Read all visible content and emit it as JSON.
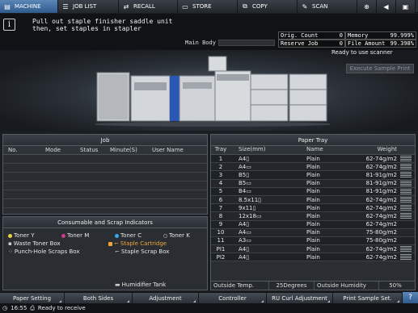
{
  "nav": {
    "tabs": [
      {
        "label": "MACHINE",
        "icon": "printer-icon"
      },
      {
        "label": "JOB LIST",
        "icon": "list-icon"
      },
      {
        "label": "RECALL",
        "icon": "recall-icon"
      },
      {
        "label": "STORE",
        "icon": "store-icon"
      },
      {
        "label": "COPY",
        "icon": "copy-icon"
      },
      {
        "label": "SCAN",
        "icon": "scan-icon"
      }
    ],
    "extra_icons": [
      "globe-icon",
      "speaker-icon",
      "lock-icon",
      "help-icon"
    ]
  },
  "message": {
    "line1": "Pull out staple finisher saddle unit",
    "line2": "then, set staples in stapler",
    "main_body_label": "Main Body"
  },
  "counters": {
    "orig_count_label": "Orig. Count",
    "orig_count": "0",
    "memory_label": "Memory",
    "memory": "99.999%",
    "reserve_job_label": "Reserve Job",
    "reserve_job": "0",
    "file_amount_label": "File Amount",
    "file_amount": "99.398%"
  },
  "status_text": "Ready to use scanner",
  "execute_sample_print": "Execute Sample Print",
  "job": {
    "title": "Job",
    "columns": [
      "No.",
      "Mode",
      "Status",
      "Minute(S)",
      "User Name"
    ]
  },
  "consumables": {
    "title": "Consumable and Scrap Indicators",
    "items": [
      {
        "label": "Toner Y",
        "color": "#e8d23a"
      },
      {
        "label": "Toner M",
        "color": "#d23a8c"
      },
      {
        "label": "Toner C",
        "color": "#3aa8e8"
      },
      {
        "label": "Toner K",
        "color": "#222222"
      },
      {
        "label": "Waste Toner Box"
      },
      {
        "label": "Staple Cartridge",
        "alert": true
      },
      {
        "label": "Punch-Hole Scraps Box"
      },
      {
        "label": "Staple Scrap Box"
      },
      {
        "label": "Humidifier Tank"
      }
    ]
  },
  "paper_tray": {
    "title": "Paper Tray",
    "columns": [
      "Tray",
      "Size(mm)",
      "Name",
      "Weight"
    ],
    "rows": [
      {
        "tray": "1",
        "size": "A4▯",
        "name": "Plain",
        "weight": "62-74g/m2",
        "level": 4
      },
      {
        "tray": "2",
        "size": "A4▭",
        "name": "Plain",
        "weight": "62-74g/m2",
        "level": 4
      },
      {
        "tray": "3",
        "size": "B5▯",
        "name": "Plain",
        "weight": "81-91g/m2",
        "level": 4
      },
      {
        "tray": "4",
        "size": "B5▭",
        "name": "Plain",
        "weight": "81-91g/m2",
        "level": 4
      },
      {
        "tray": "5",
        "size": "B4▭",
        "name": "Plain",
        "weight": "81-91g/m2",
        "level": 4
      },
      {
        "tray": "6",
        "size": "8.5x11▯",
        "name": "Plain",
        "weight": "62-74g/m2",
        "level": 4
      },
      {
        "tray": "7",
        "size": "9x11▯",
        "name": "Plain",
        "weight": "62-74g/m2",
        "level": 4
      },
      {
        "tray": "8",
        "size": "12x18▭",
        "name": "Plain",
        "weight": "62-74g/m2",
        "level": 4
      },
      {
        "tray": "9",
        "size": "A4▯",
        "name": "Plain",
        "weight": "62-74g/m2",
        "level": 0
      },
      {
        "tray": "10",
        "size": "A4▭",
        "name": "Plain",
        "weight": "75-80g/m2",
        "level": 0
      },
      {
        "tray": "11",
        "size": "A3▭",
        "name": "Plain",
        "weight": "75-80g/m2",
        "level": 0
      },
      {
        "tray": "PI1",
        "size": "A4▯",
        "name": "Plain",
        "weight": "62-74g/m2",
        "level": 4
      },
      {
        "tray": "PI2",
        "size": "A4▯",
        "name": "Plain",
        "weight": "62-74g/m2",
        "level": 4
      }
    ],
    "outside_temp_label": "Outside Temp.",
    "outside_temp": "25Degrees",
    "outside_humidity_label": "Outside Humidity",
    "outside_humidity": "50%"
  },
  "bottom_buttons": [
    "Paper Setting",
    "Both Sides",
    "Adjustment",
    "Controller",
    "RU Curl Adjustment",
    "Print Sample Set."
  ],
  "statusbar": {
    "time": "16:55",
    "text": "Ready to receive"
  }
}
